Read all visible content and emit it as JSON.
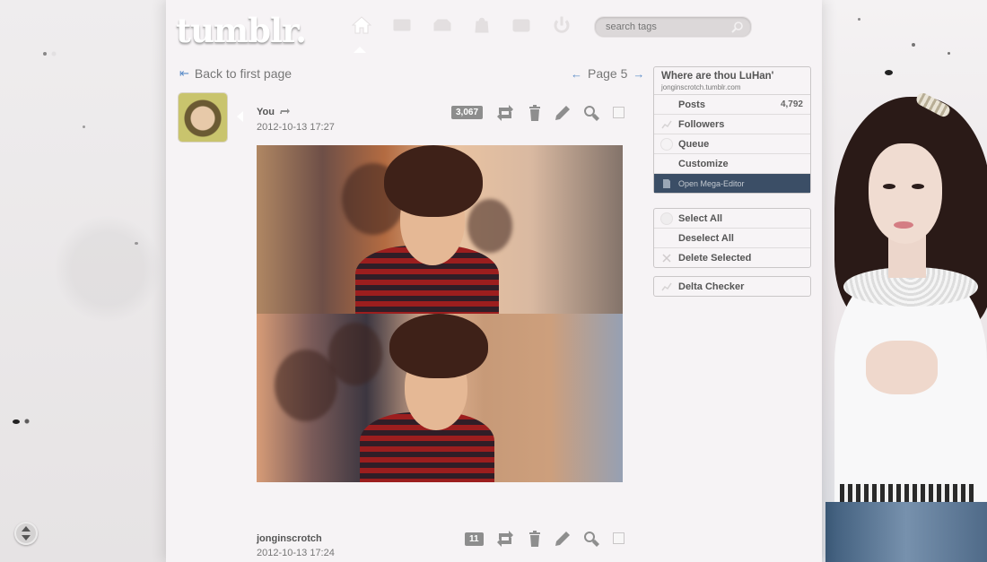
{
  "header": {
    "logo_text": "tumblr.",
    "nav_icons": [
      "home-icon",
      "mail-icon",
      "inbox-icon",
      "shop-icon",
      "activity-icon",
      "power-icon"
    ],
    "search_placeholder": "search tags"
  },
  "pagination": {
    "back_label": "Back to first page",
    "page_label": "Page 5"
  },
  "posts": [
    {
      "user": "You",
      "reblog": true,
      "date": "2012-10-13 17:27",
      "notes": "3,067"
    },
    {
      "user": "jonginscrotch",
      "reblog": false,
      "date": "2012-10-13 17:24",
      "notes": "11"
    }
  ],
  "sidebar": {
    "blog_title": "Where are thou LuHan'",
    "blog_url": "jonginscrotch.tumblr.com",
    "menu": [
      {
        "label": "Posts",
        "count": "4,792",
        "icon": "posts-icon"
      },
      {
        "label": "Followers",
        "count": "",
        "icon": "followers-icon"
      },
      {
        "label": "Queue",
        "count": "",
        "icon": "queue-icon"
      },
      {
        "label": "Customize",
        "count": "",
        "icon": "customize-icon"
      },
      {
        "label": "Open Mega-Editor",
        "count": "",
        "icon": "document-icon"
      }
    ],
    "selection": [
      {
        "label": "Select All"
      },
      {
        "label": "Deselect All"
      },
      {
        "label": "Delete Selected"
      }
    ],
    "delta_label": "Delta Checker"
  },
  "colors": {
    "accent": "#5b8cc8",
    "mega_editor_bg": "#3b4e66",
    "note_badge": "#8d8d8d"
  }
}
